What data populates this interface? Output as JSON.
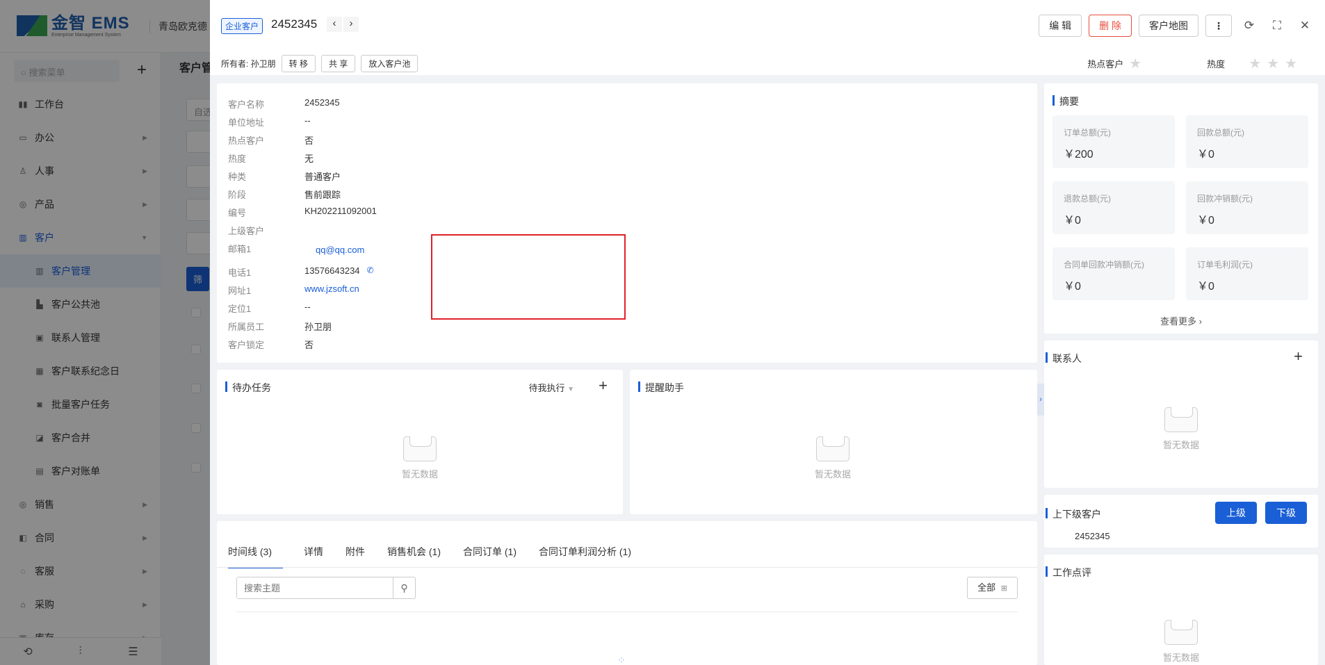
{
  "app": {
    "logo_main": "金智 EMS",
    "logo_sub": "Enterprise Management System",
    "company": "青岛欧克德",
    "sidebar_search_placeholder": "搜索菜单",
    "menu": [
      {
        "label": "工作台",
        "icon": "dashboard-icon"
      },
      {
        "label": "办公",
        "icon": "monitor-icon",
        "arrow": "▶"
      },
      {
        "label": "人事",
        "icon": "people-icon",
        "arrow": "▶"
      },
      {
        "label": "产品",
        "icon": "product-icon",
        "arrow": "▶"
      },
      {
        "label": "客户",
        "icon": "customer-icon",
        "arrow": "▼"
      }
    ],
    "submenu": [
      "客户管理",
      "客户公共池",
      "联系人管理",
      "客户联系纪念日",
      "批量客户任务",
      "客户合并",
      "客户对账单"
    ],
    "menu2": [
      {
        "label": "销售",
        "icon": "sales-icon",
        "arrow": "▶"
      },
      {
        "label": "合同",
        "icon": "contract-icon",
        "arrow": "▶"
      },
      {
        "label": "客服",
        "icon": "service-icon",
        "arrow": "▶"
      },
      {
        "label": "采购",
        "icon": "purchase-icon",
        "arrow": "▶"
      },
      {
        "label": "库存",
        "icon": "inventory-icon",
        "arrow": "▶"
      }
    ],
    "page_title": "客户管",
    "filter_partial": "自选",
    "filter_btn": "筛"
  },
  "drawer": {
    "type_tag": "企业客户",
    "title": "2452345",
    "actions": {
      "edit": "编 辑",
      "delete": "删 除",
      "map": "客户地图",
      "more": "⋮"
    },
    "owner_label": "所有者: 孙卫朋",
    "buttons": {
      "transfer": "转 移",
      "share": "共 享",
      "to_pool": "放入客户池"
    },
    "hot_label": "热点客户",
    "heat_label": "热度",
    "heat_stars": 0
  },
  "info": [
    {
      "label": "客户名称",
      "value": "2452345"
    },
    {
      "label": "单位地址",
      "value": "--"
    },
    {
      "label": "热点客户",
      "value": "否"
    },
    {
      "label": "热度",
      "value": "无"
    },
    {
      "label": "种类",
      "value": "普通客户"
    },
    {
      "label": "阶段",
      "value": "售前跟踪"
    },
    {
      "label": "编号",
      "value": "KH202211092001"
    },
    {
      "label": "上级客户",
      "value": ""
    },
    {
      "label": "邮箱1",
      "value": "qq@qq.com"
    },
    {
      "label": "电话1",
      "value": "13576643234"
    },
    {
      "label": "网址1",
      "value": "www.jzsoft.cn"
    },
    {
      "label": "定位1",
      "value": "--"
    },
    {
      "label": "所属员工",
      "value": "孙卫朋"
    },
    {
      "label": "客户锁定",
      "value": "否"
    }
  ],
  "todo": {
    "title": "待办任务",
    "filter": "待我执行",
    "empty": "暂无数据"
  },
  "reminder": {
    "title": "提醒助手",
    "empty": "暂无数据"
  },
  "timeline": {
    "tabs": [
      "时间线 (3)",
      "详情",
      "附件",
      "销售机会 (1)",
      "合同订单 (1)",
      "合同订单利润分析 (1)"
    ],
    "search_placeholder": "搜索主题",
    "all_label": "全部"
  },
  "summary": {
    "title": "摘要",
    "stats": [
      {
        "label": "订单总额(元)",
        "value": "￥200"
      },
      {
        "label": "回款总额(元)",
        "value": "￥0"
      },
      {
        "label": "退款总额(元)",
        "value": "￥0"
      },
      {
        "label": "回款冲销额(元)",
        "value": "￥0"
      },
      {
        "label": "合同单回款冲销额(元)",
        "value": "￥0"
      },
      {
        "label": "订单毛利润(元)",
        "value": "￥0"
      }
    ],
    "more": "查看更多"
  },
  "contacts": {
    "title": "联系人",
    "empty": "暂无数据"
  },
  "hierarchy": {
    "title": "上下级客户",
    "up": "上级",
    "down": "下级",
    "item": "2452345"
  },
  "review": {
    "title": "工作点评",
    "empty": "暂无数据"
  },
  "colors": {
    "primary": "#1a5fd6",
    "danger": "#e74c3c",
    "highlight": "#e0202a"
  }
}
